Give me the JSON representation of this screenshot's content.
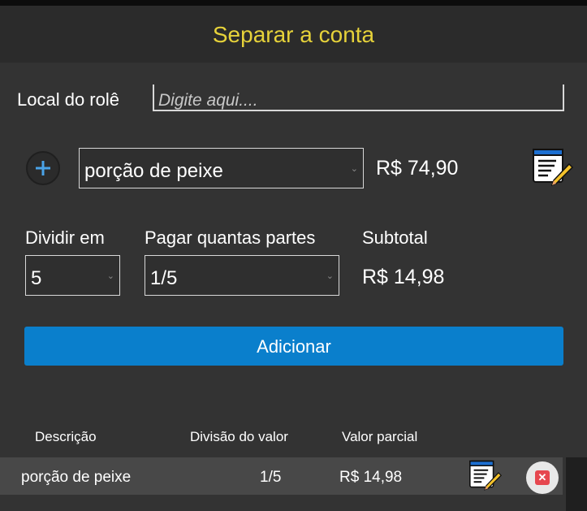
{
  "header": {
    "title": "Separar a conta"
  },
  "form": {
    "local_label": "Local do rolê",
    "local_placeholder": "Digite aqui....",
    "item_selected": "porção de peixe",
    "item_price": "R$ 74,90",
    "dividir_label": "Dividir em",
    "dividir_value": "5",
    "partes_label": "Pagar quantas partes",
    "partes_value": "1/5",
    "subtotal_label": "Subtotal",
    "subtotal_value": "R$ 14,98",
    "add_button": "Adicionar"
  },
  "table": {
    "headers": [
      "Descrição",
      "Divisão do valor",
      "Valor parcial"
    ],
    "rows": [
      {
        "descricao": "porção de peixe",
        "divisao": "1/5",
        "valor": "R$ 14,98"
      }
    ]
  },
  "icons": {
    "add": "plus-circle-icon",
    "edit": "edit-document-icon",
    "delete": "close-icon"
  },
  "colors": {
    "title": "#e6d23a",
    "primary_button": "#0a7fcc",
    "delete": "#e6474f"
  }
}
